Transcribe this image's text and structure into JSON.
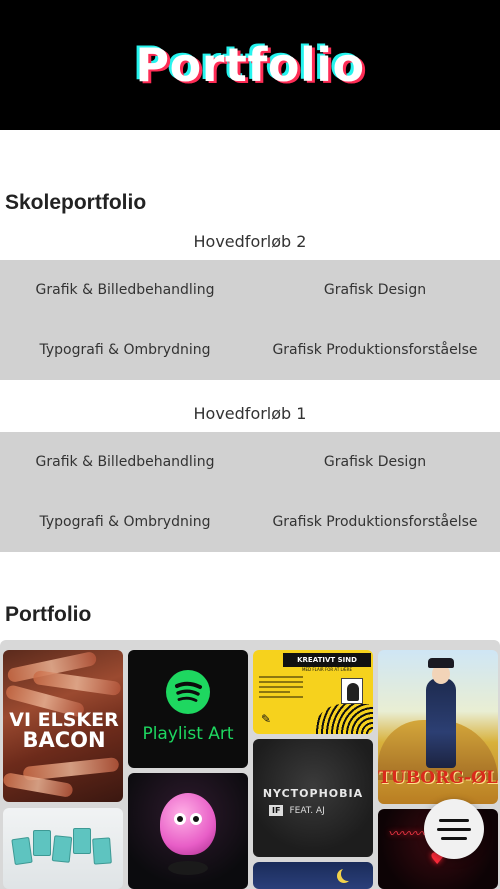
{
  "header": {
    "logo_text": "Portfolio",
    "colors": {
      "background": "#000000",
      "cyan": "#25f4ee",
      "red": "#fe2c55",
      "white": "#ffffff"
    }
  },
  "school_portfolio": {
    "title": "Skoleportfolio",
    "groups": [
      {
        "heading": "Hovedforløb 2",
        "items": [
          "Grafik & Billedbehandling",
          "Grafisk Design",
          "Typografi & Ombrydning",
          "Grafisk Produktionsforståelse"
        ]
      },
      {
        "heading": "Hovedforløb 1",
        "items": [
          "Grafik & Billedbehandling",
          "Grafisk Design",
          "Typografi & Ombrydning",
          "Grafisk Produktionsforståelse"
        ]
      }
    ]
  },
  "portfolio": {
    "title": "Portfolio",
    "tiles": [
      {
        "name": "bacon-poster",
        "text": [
          "VI ELSKER",
          "BACON"
        ]
      },
      {
        "name": "spotify-playlist-art",
        "text": [
          "Playlist Art"
        ]
      },
      {
        "name": "kreativt-sind-poster",
        "text": [
          "KREATIVT SIND",
          "MED FLAIR FOR AT LÆRE"
        ]
      },
      {
        "name": "tuborg-poster",
        "text": [
          "TUBORG-ØL"
        ]
      },
      {
        "name": "nyctophobia-cover",
        "text": [
          "NYCTOPHOBIA",
          "FEAT. AJ"
        ]
      },
      {
        "name": "pink-creature-render",
        "text": []
      },
      {
        "name": "card-mockup",
        "text": []
      },
      {
        "name": "red-neon-sign",
        "text": []
      },
      {
        "name": "night-sky-illustration",
        "text": []
      }
    ]
  },
  "menu_button": {
    "icon": "hamburger-menu-icon"
  }
}
